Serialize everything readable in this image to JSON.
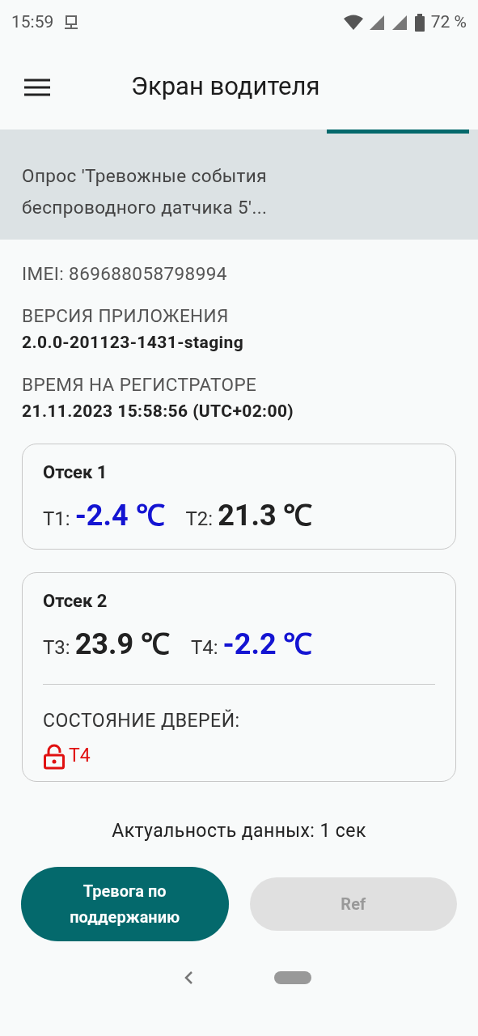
{
  "status_bar": {
    "time": "15:59",
    "battery": "72 %"
  },
  "app_bar": {
    "title": "Экран водителя"
  },
  "banner": {
    "text": "Опрос 'Тревожные события беспроводного датчика 5'..."
  },
  "info": {
    "imei": "IMEI: 869688058798994",
    "version_label": "ВЕРСИЯ ПРИЛОЖЕНИЯ",
    "version": "2.0.0-201123-1431-staging",
    "time_label": "ВРЕМЯ НА РЕГИСТРАТОРЕ",
    "time": "21.11.2023 15:58:56 (UTC+02:00)"
  },
  "compartments": [
    {
      "title": "Отсек 1",
      "readings": [
        {
          "label": "T1:",
          "value": "-2.4 ℃",
          "color": "#1414d2"
        },
        {
          "label": "T2:",
          "value": "21.3 ℃",
          "color": "#222222"
        }
      ]
    },
    {
      "title": "Отсек 2",
      "readings": [
        {
          "label": "T3:",
          "value": "23.9 ℃",
          "color": "#222222"
        },
        {
          "label": "T4:",
          "value": "-2.2 ℃",
          "color": "#1414d2"
        }
      ],
      "doors": {
        "label": "СОСТОЯНИЕ ДВЕРЕЙ:",
        "items": [
          {
            "name": "T4",
            "locked": false
          }
        ]
      }
    }
  ],
  "freshness": "Актуальность данных: 1 сек",
  "buttons": [
    {
      "label": "Тревога по поддержанию",
      "disabled": false
    },
    {
      "label": "Ref",
      "disabled": true
    }
  ]
}
